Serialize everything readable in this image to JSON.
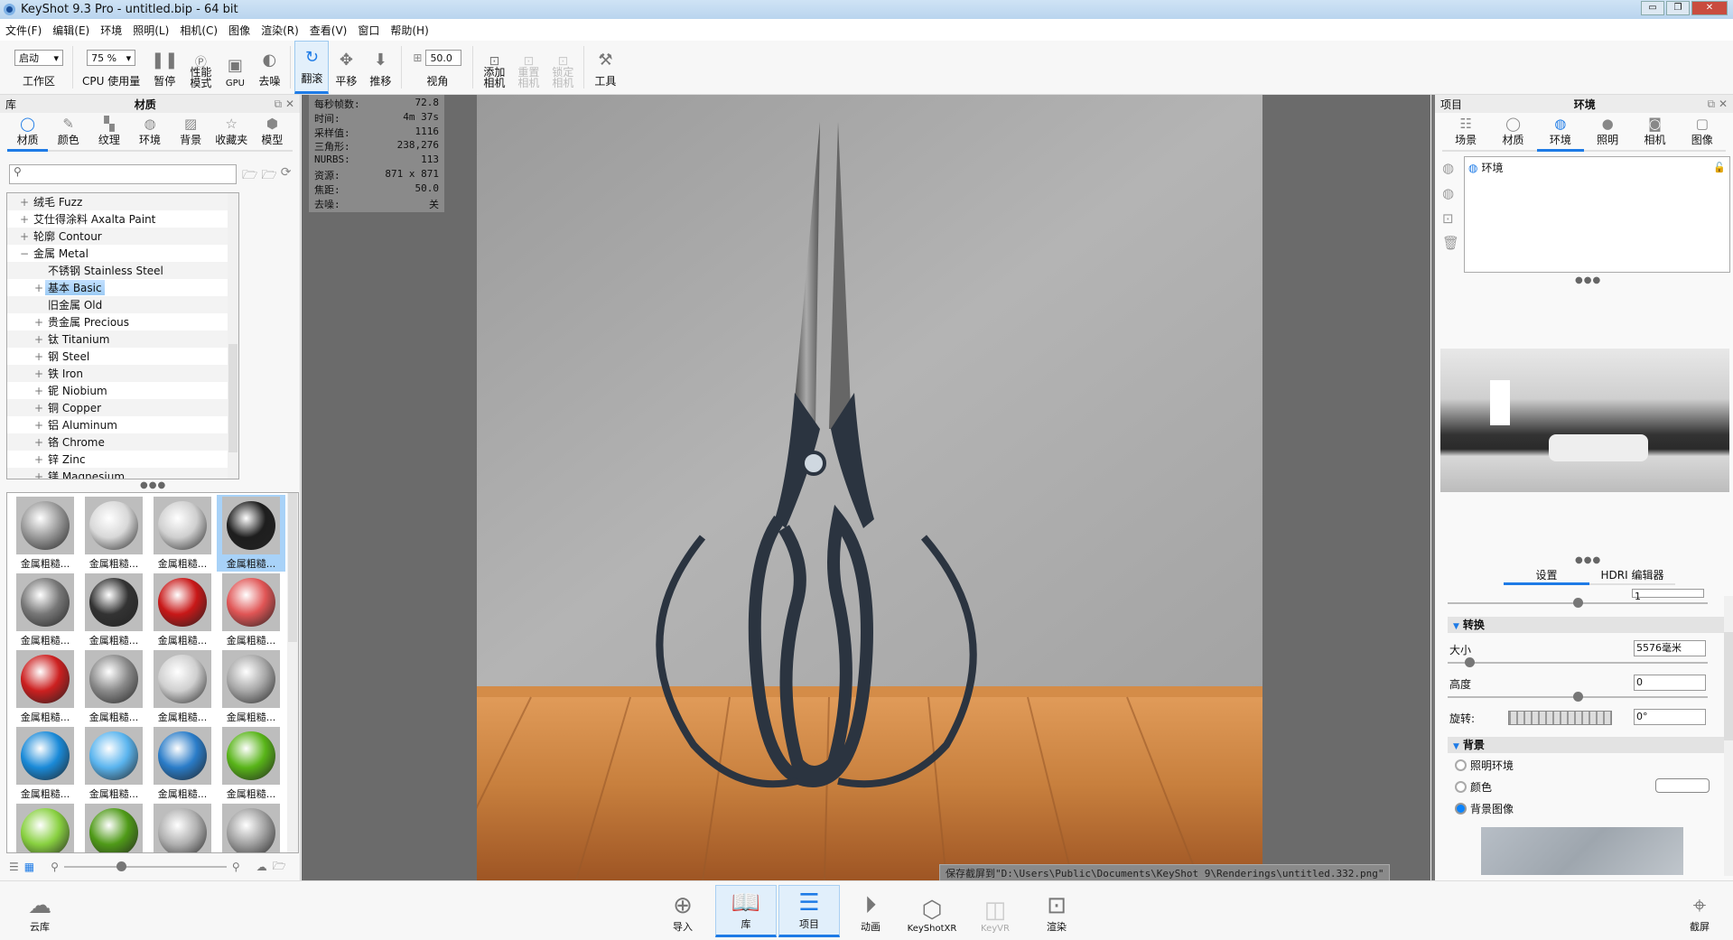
{
  "window": {
    "title": "KeyShot 9.3 Pro  - untitled.bip  - 64 bit",
    "minimize": "▭",
    "restore": "❐",
    "close": "✕"
  },
  "menu": [
    "文件(F)",
    "编辑(E)",
    "环境",
    "照明(L)",
    "相机(C)",
    "图像",
    "渲染(R)",
    "查看(V)",
    "窗口",
    "帮助(H)"
  ],
  "toolbar": {
    "workspace_value": "启动",
    "workspace_label": "工作区",
    "cpu_value": "75 %",
    "cpu_label": "CPU 使用量",
    "pause": "暂停",
    "perf": "性能\n模式",
    "gpu": "GPU",
    "denoise": "去噪",
    "tumble": "翻滚",
    "pan": "平移",
    "dolly": "推移",
    "fov_value": "50.0",
    "fov_label": "视角",
    "add_camera": "添加\n相机",
    "reset_camera": "重置\n相机",
    "lock_camera": "锁定\n相机",
    "tools": "工具"
  },
  "library": {
    "header_left": "库",
    "header_title": "材质",
    "tabs": [
      "材质",
      "颜色",
      "纹理",
      "环境",
      "背景",
      "收藏夹",
      "模型"
    ],
    "search_placeholder": "",
    "tree": [
      {
        "label": "绒毛 Fuzz",
        "level": 0,
        "expander": "+"
      },
      {
        "label": "艾仕得涂料 Axalta Paint",
        "level": 0,
        "expander": "+"
      },
      {
        "label": "轮廓 Contour",
        "level": 0,
        "expander": "+"
      },
      {
        "label": "金属 Metal",
        "level": 0,
        "expander": "−"
      },
      {
        "label": "不锈钢 Stainless Steel",
        "level": 1,
        "expander": ""
      },
      {
        "label": "基本 Basic",
        "level": 1,
        "expander": "+",
        "selected": true
      },
      {
        "label": "旧金属 Old",
        "level": 1,
        "expander": ""
      },
      {
        "label": "贵金属 Precious",
        "level": 1,
        "expander": "+"
      },
      {
        "label": "钛 Titanium",
        "level": 1,
        "expander": "+"
      },
      {
        "label": "钢 Steel",
        "level": 1,
        "expander": "+"
      },
      {
        "label": "铁 Iron",
        "level": 1,
        "expander": "+"
      },
      {
        "label": "铌 Niobium",
        "level": 1,
        "expander": "+"
      },
      {
        "label": "铜 Copper",
        "level": 1,
        "expander": "+"
      },
      {
        "label": "铝 Aluminum",
        "level": 1,
        "expander": "+"
      },
      {
        "label": "铬 Chrome",
        "level": 1,
        "expander": "+"
      },
      {
        "label": "锌 Zinc",
        "level": 1,
        "expander": "+"
      },
      {
        "label": "镁 Magnesium",
        "level": 1,
        "expander": "+"
      }
    ],
    "thumb_label": "金属粗糙...",
    "thumb_colors": [
      "#9a9a9a",
      "#d8d8d8",
      "#cfcfcf",
      "#1e1e1e",
      "#777",
      "#333",
      "#c81818",
      "#e05555",
      "#cc2020",
      "#8a8a8a",
      "#cfcfcf",
      "#a8a8a8",
      "#1a8ad8",
      "#5ab4ee",
      "#2a7cc8",
      "#58b418",
      "#88d040",
      "#4f9a18",
      "#b0b0b0",
      "#a0a0a0"
    ],
    "selected_thumb": 3
  },
  "stats": [
    [
      "每秒帧数:",
      "72.8"
    ],
    [
      "时间:",
      "4m 37s"
    ],
    [
      "采样值:",
      "1116"
    ],
    [
      "三角形:",
      "238,276"
    ],
    [
      "NURBS:",
      "113"
    ],
    [
      "资源:",
      "871 x 871"
    ],
    [
      "焦距:",
      "50.0"
    ],
    [
      "去噪:",
      "关"
    ]
  ],
  "status_message": "保存截屏到\"D:\\Users\\Public\\Documents\\KeyShot 9\\Renderings\\untitled.332.png\"",
  "project": {
    "header_left": "项目",
    "header_title": "环境",
    "tabs": [
      "场景",
      "材质",
      "环境",
      "照明",
      "相机",
      "图像"
    ],
    "env_item": "环境",
    "subtabs": [
      "设置",
      "HDRI 编辑器"
    ],
    "contrast_value": "1",
    "transform_title": "转换",
    "size_label": "大小",
    "size_value": "5576毫米",
    "size_slider": 0.07,
    "height_label": "高度",
    "height_value": "0",
    "height_slider": 0.5,
    "contrast_slider": 0.5,
    "rotation_label": "旋转:",
    "rotation_value": "0°",
    "background_title": "背景",
    "bg_options": [
      "照明环境",
      "颜色",
      "背景图像"
    ],
    "bg_selected": 2
  },
  "bottom": {
    "cloud": "云库",
    "import": "导入",
    "library": "库",
    "project": "项目",
    "animation": "动画",
    "keyshotxr": "KeyShotXR",
    "keyvr": "KeyVR",
    "render": "渲染",
    "screenshot": "截屏"
  },
  "colors": {
    "accent": "#1e7be6",
    "viewport": "#6b6b6b",
    "wall": "#a9a9a9",
    "wood": "#c8803e"
  }
}
